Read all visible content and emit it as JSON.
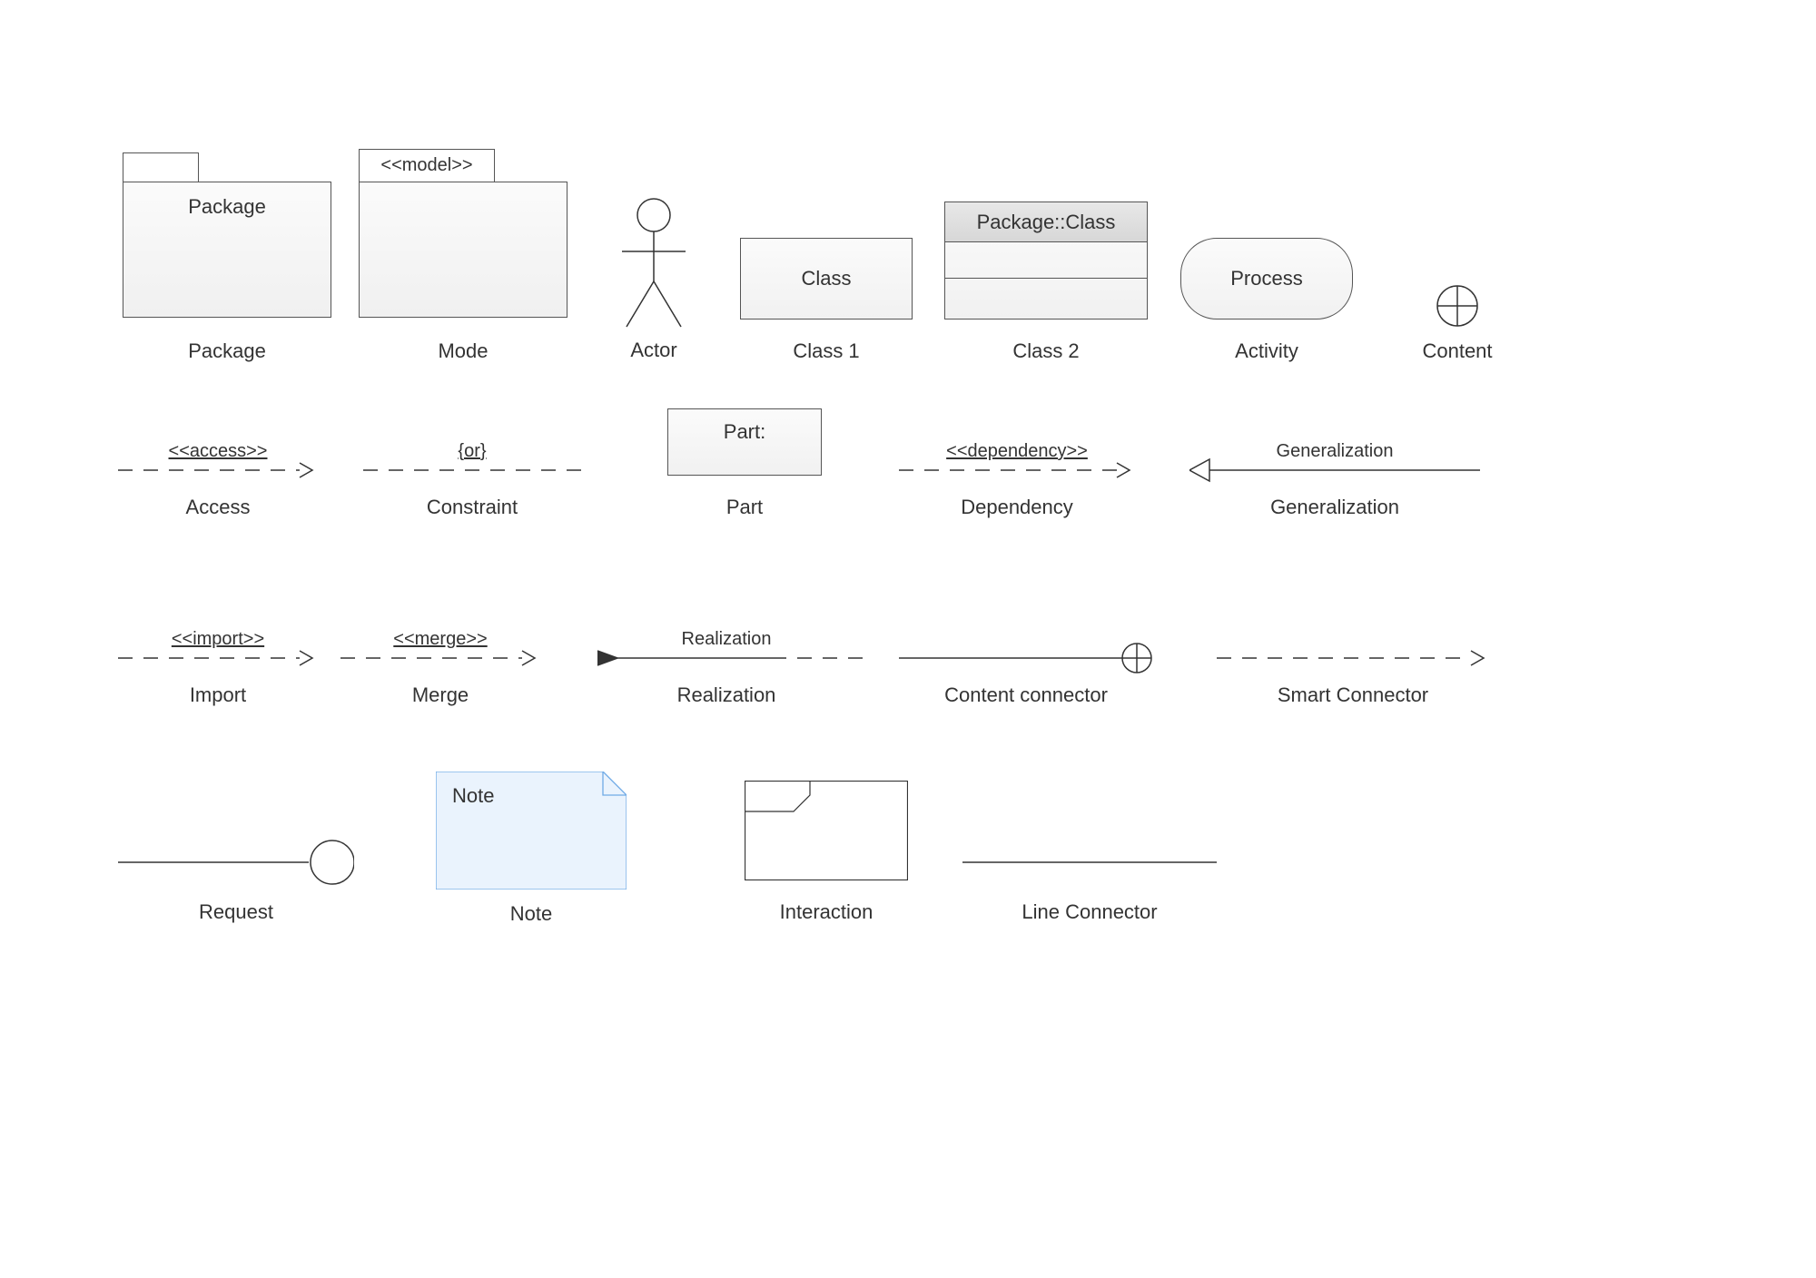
{
  "row1": {
    "package": {
      "label": "Package",
      "caption": "Package"
    },
    "model": {
      "stereotype": "<<model>>",
      "caption": "Mode"
    },
    "actor": {
      "caption": "Actor"
    },
    "class1": {
      "label": "Class",
      "caption": "Class 1"
    },
    "class2": {
      "label": "Package::Class",
      "caption": "Class 2"
    },
    "activity": {
      "label": "Process",
      "caption": "Activity"
    },
    "content": {
      "caption": "Content"
    }
  },
  "row2": {
    "access": {
      "label": "<<access>>",
      "caption": "Access"
    },
    "constraint": {
      "label": "{or}",
      "caption": "Constraint"
    },
    "part": {
      "label": "Part:",
      "caption": "Part"
    },
    "dependency": {
      "label": "<<dependency>>",
      "caption": "Dependency"
    },
    "generalization": {
      "label": "Generalization",
      "caption": "Generalization"
    }
  },
  "row3": {
    "import": {
      "label": "<<import>>",
      "caption": "Import"
    },
    "merge": {
      "label": "<<merge>>",
      "caption": "Merge"
    },
    "realization": {
      "label": "Realization",
      "caption": "Realization"
    },
    "contentconn": {
      "caption": "Content connector"
    },
    "smartconn": {
      "caption": "Smart Connector"
    }
  },
  "row4": {
    "request": {
      "caption": "Request"
    },
    "note": {
      "label": "Note",
      "caption": "Note"
    },
    "interaction": {
      "caption": "Interaction"
    },
    "lineconn": {
      "caption": "Line Connector"
    }
  }
}
